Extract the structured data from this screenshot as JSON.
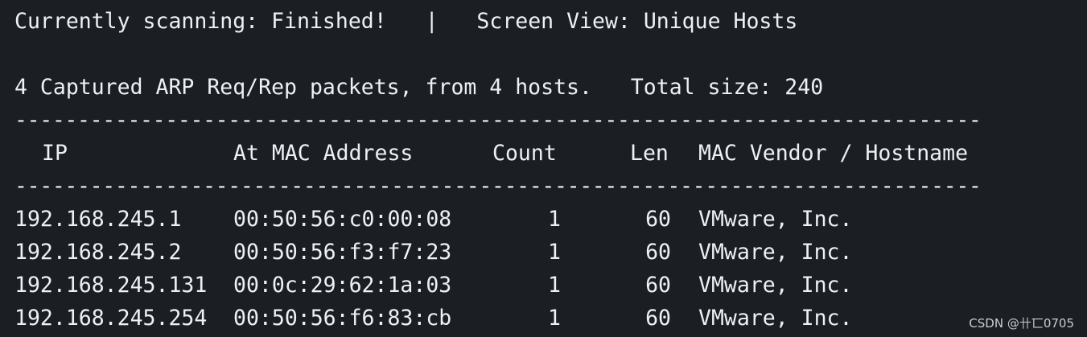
{
  "status": {
    "scanning_label": "Currently scanning: Finished!",
    "divider": "|",
    "screen_view_label": "Screen View: Unique Hosts"
  },
  "summary": {
    "text": "4 Captured ARP Req/Rep packets, from 4 hosts.",
    "total_size": "Total size: 240"
  },
  "separator": "-----------------------------------------------------------------------------",
  "table": {
    "headers": {
      "ip": "IP",
      "mac": "At MAC Address",
      "count": "Count",
      "len": "Len",
      "vendor": "MAC Vendor / Hostname"
    },
    "rows": [
      {
        "ip": "192.168.245.1",
        "mac": "00:50:56:c0:00:08",
        "count": "1",
        "len": "60",
        "vendor": "VMware, Inc."
      },
      {
        "ip": "192.168.245.2",
        "mac": "00:50:56:f3:f7:23",
        "count": "1",
        "len": "60",
        "vendor": "VMware, Inc."
      },
      {
        "ip": "192.168.245.131",
        "mac": "00:0c:29:62:1a:03",
        "count": "1",
        "len": "60",
        "vendor": "VMware, Inc."
      },
      {
        "ip": "192.168.245.254",
        "mac": "00:50:56:f6:83:cb",
        "count": "1",
        "len": "60",
        "vendor": "VMware, Inc."
      }
    ]
  },
  "watermark": "CSDN @卄匸0705",
  "colors": {
    "background": "#1b1f24",
    "foreground": "#eef0f3"
  }
}
